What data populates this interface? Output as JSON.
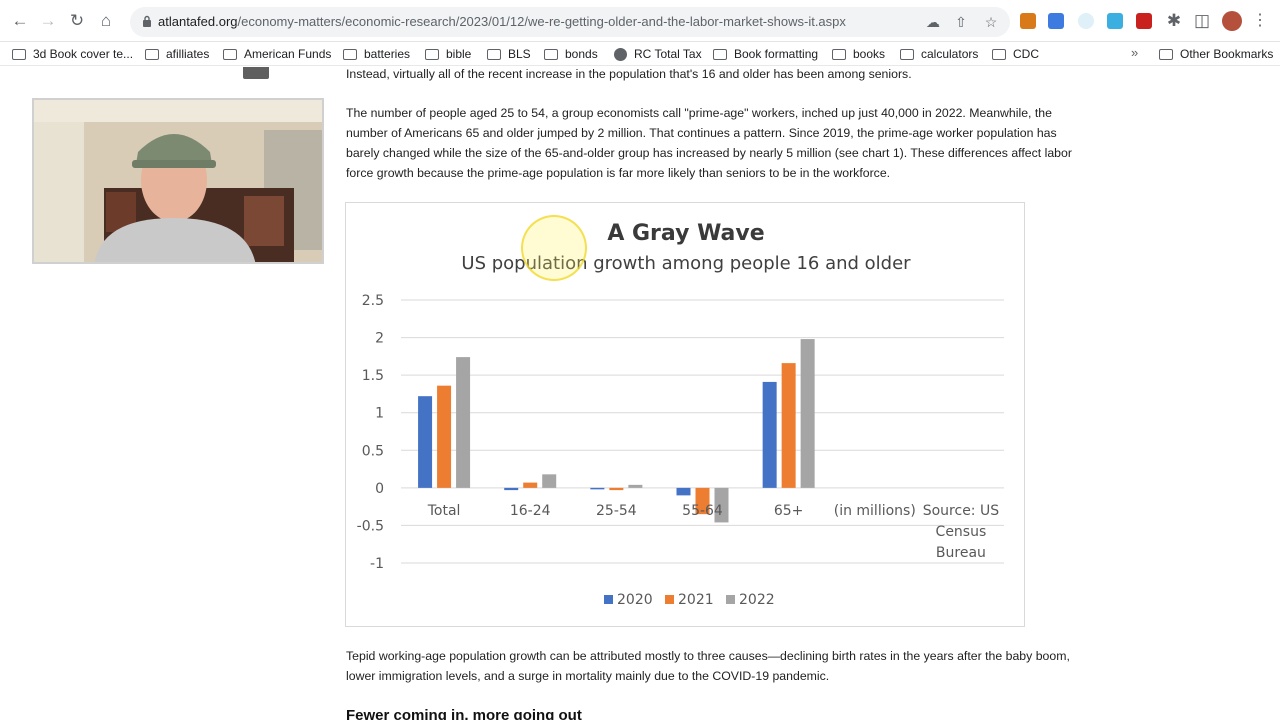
{
  "browser": {
    "url_host": "atlantafed.org",
    "url_path": "/economy-matters/economic-research/2023/01/12/we-re-getting-older-and-the-labor-market-shows-it.aspx",
    "bookmarks": [
      "3d Book cover te...",
      "afilliates",
      "American Funds",
      "batteries",
      "bible",
      "BLS",
      "bonds",
      "RC Total Tax",
      "Book formatting",
      "books",
      "calculators",
      "CDC"
    ],
    "overflow": "»",
    "other_bookmarks": "Other Bookmarks"
  },
  "article": {
    "para_top": "Instead, virtually all of the recent increase in the population that's 16 and older has been among seniors.",
    "para_main": "The number of people aged 25 to 54, a group economists call \"prime-age\" workers, inched up just 40,000 in 2022. Meanwhile, the number of Americans 65 and older jumped by 2 million. That continues a pattern. Since 2019, the prime-age worker population has barely changed while the size of the 65-and-older group has increased by nearly 5 million (see chart 1). These differences affect labor force growth because the prime-age population is far more likely than seniors to be in the workforce.",
    "para_after": "Tepid working-age population growth can be attributed mostly to three causes—declining birth rates in the years after the baby boom, lower immigration levels, and a surge in mortality mainly due to the COVID-19 pandemic.",
    "heading": "Fewer coming in, more going out"
  },
  "chart_data": {
    "type": "bar",
    "title": "A Gray Wave",
    "subtitle": "US population growth among people 16 and older",
    "categories": [
      "Total",
      "16-24",
      "25-54",
      "55-64",
      "65+",
      "(in millions)",
      "Source: US Census Bureau"
    ],
    "series": [
      {
        "name": "2020",
        "color": "#4472c4",
        "values": [
          1.22,
          -0.03,
          -0.02,
          -0.1,
          1.41,
          null,
          null
        ]
      },
      {
        "name": "2021",
        "color": "#ed7d31",
        "values": [
          1.36,
          0.07,
          -0.03,
          -0.35,
          1.66,
          null,
          null
        ]
      },
      {
        "name": "2022",
        "color": "#a5a5a5",
        "values": [
          1.74,
          0.18,
          0.04,
          -0.46,
          1.98,
          null,
          null
        ]
      }
    ],
    "yticks": [
      "2.5",
      "2",
      "1.5",
      "1",
      "0.5",
      "0",
      "-0.5",
      "-1"
    ],
    "ylim": [
      -1,
      2.5
    ],
    "grid": true,
    "legend": "bottom"
  }
}
